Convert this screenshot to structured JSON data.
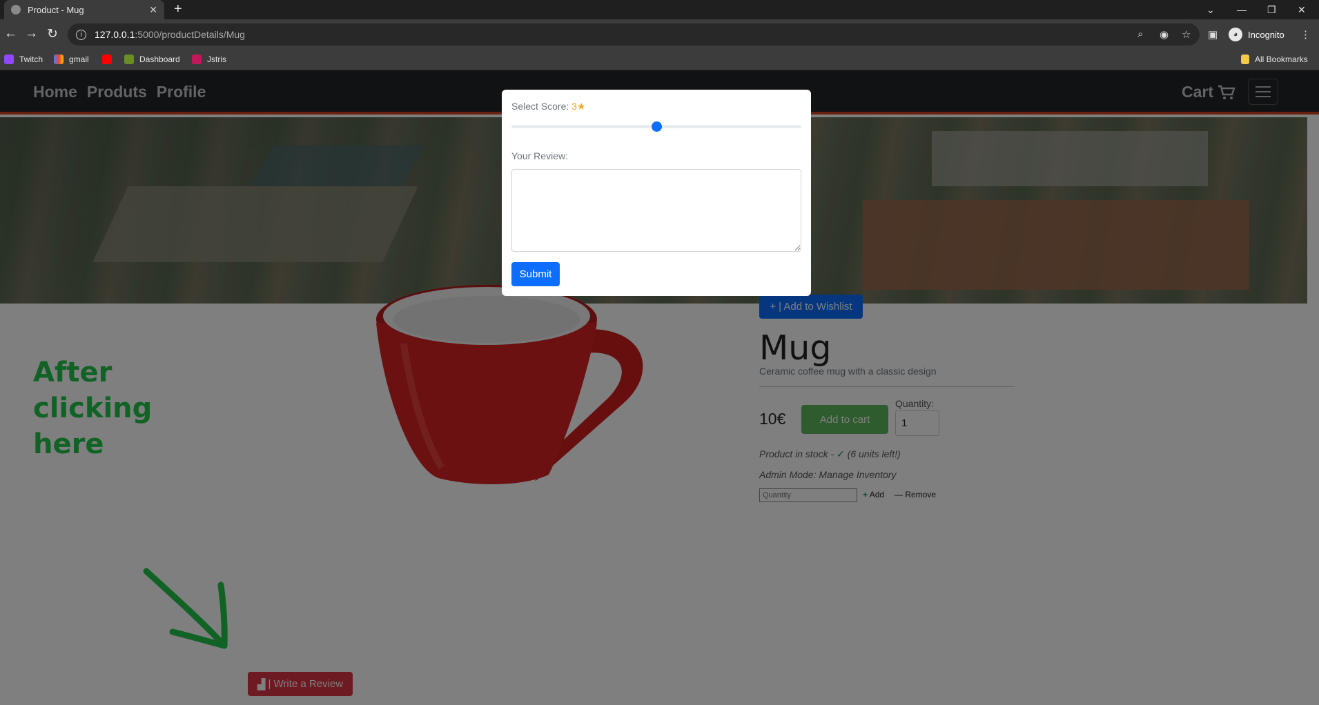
{
  "browser": {
    "tab_title": "Product - Mug",
    "url_host": "127.0.0.1",
    "url_path": ":5000/productDetails/Mug",
    "profile_label": "Incognito",
    "bookmarks": [
      "Twitch",
      "gmail",
      "Dashboard",
      "Jstris"
    ],
    "all_bookmarks_label": "All Bookmarks"
  },
  "nav": {
    "links": [
      "Home",
      "Produts",
      "Profile"
    ],
    "cart_label": "Cart"
  },
  "product": {
    "wishlist_label": "| Add to Wishlist",
    "name": "Mug",
    "description": "Ceramic coffee mug with a classic design",
    "price": "10€",
    "add_to_cart_label": "Add to cart",
    "quantity_label": "Quantity:",
    "quantity_value": "1",
    "stock_text_pre": "Product in stock - ",
    "stock_text_post": " (6 units left!)",
    "admin_label": "Admin Mode: Manage Inventory",
    "inventory_placeholder": "Quantity",
    "inventory_add_label": "Add",
    "inventory_remove_label": "Remove",
    "write_review_label": "| Write a Review"
  },
  "annotation": {
    "text_line1": "After clicking",
    "text_line2": "here"
  },
  "modal": {
    "score_label": "Select Score: ",
    "score_value": "3",
    "score_fraction": 0.5,
    "review_label": "Your Review:",
    "review_value": "",
    "submit_label": "Submit"
  },
  "colors": {
    "nav_accent": "#d0421c",
    "primary": "#0d6efd",
    "success": "#5cb85c",
    "danger": "#dc3545",
    "annotation": "#22c54a"
  }
}
